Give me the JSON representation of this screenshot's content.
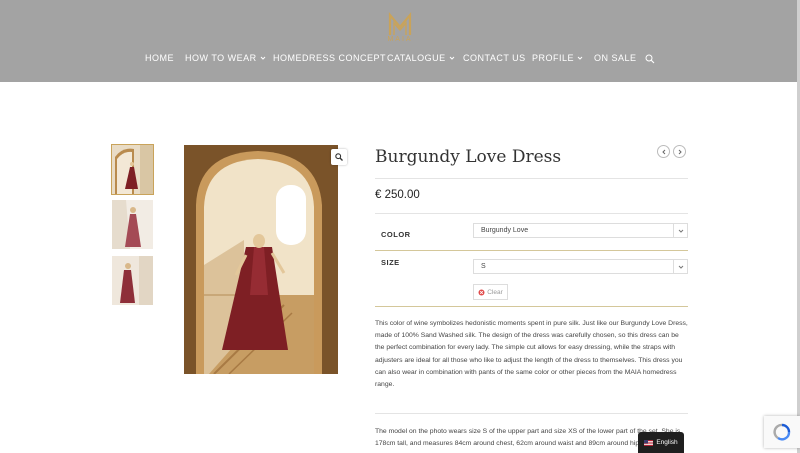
{
  "header": {
    "logo_text": "MAIA",
    "nav": [
      {
        "label": "HOME",
        "has_caret": false
      },
      {
        "label": "HOW TO WEAR",
        "has_caret": true
      },
      {
        "label": "HOMEDRESS CONCEPT",
        "has_caret": false
      },
      {
        "label": "CATALOGUE",
        "has_caret": true
      },
      {
        "label": "CONTACT US",
        "has_caret": false
      },
      {
        "label": "PROFILE",
        "has_caret": true
      },
      {
        "label": "ON SALE",
        "has_caret": false
      }
    ],
    "search_icon": "search-icon"
  },
  "product": {
    "title": "Burgundy Love Dress",
    "price": "€ 250.00",
    "variations": {
      "color_label": "COLOR",
      "color_value": "Burgundy Love",
      "size_label": "SIZE",
      "size_value": "S",
      "clear_label": "Clear"
    },
    "description": "This color of wine symbolizes hedonistic moments spent in pure silk. Just like our Burgundy Love Dress, made of 100% Sand Washed silk. The design of the dress was carefully chosen, so this dress can be the perfect combination for every lady. The simple cut allows for easy dressing, while the straps with adjusters are ideal for all those who like to adjust the length of the dress to themselves. This dress you can also wear in combination with pants of the same color or other pieces from the MAIA homedress range.",
    "model_info": "The model on the photo wears size S of the upper part and size XS of the lower part of the set. She is 178cm tall, and measures 84cm around chest, 62cm around waist and 89cm around hips."
  },
  "language": {
    "label": "English"
  },
  "colors": {
    "header_bg": "#a3a3a3",
    "accent_gold": "#c9a35a",
    "dress": "#7e1f24"
  }
}
